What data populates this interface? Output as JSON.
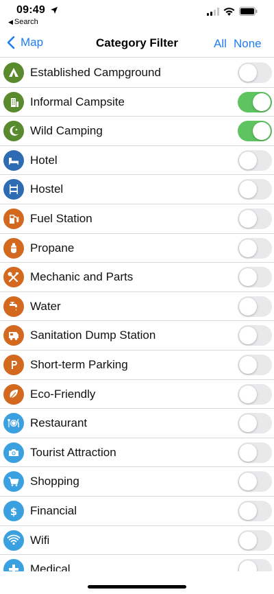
{
  "status_bar": {
    "time": "09:49",
    "back_app": "Search"
  },
  "nav": {
    "back_label": "Map",
    "title": "Category Filter",
    "all_label": "All",
    "none_label": "None"
  },
  "colors": {
    "green": "#5a8a2e",
    "blue": "#2d6bb3",
    "orange": "#d2691e",
    "light_blue": "#3aa0e0",
    "toggle_on": "#5ec45f",
    "link": "#1e7cf2"
  },
  "categories": [
    {
      "label": "Established Campground",
      "icon": "tent-icon",
      "color": "#5a8a2e",
      "on": false
    },
    {
      "label": "Informal Campsite",
      "icon": "building-icon",
      "color": "#5a8a2e",
      "on": true
    },
    {
      "label": "Wild Camping",
      "icon": "moon-icon",
      "color": "#5a8a2e",
      "on": true
    },
    {
      "label": "Hotel",
      "icon": "bed-icon",
      "color": "#2d6bb3",
      "on": false
    },
    {
      "label": "Hostel",
      "icon": "bunk-bed-icon",
      "color": "#2d6bb3",
      "on": false
    },
    {
      "label": "Fuel Station",
      "icon": "fuel-pump-icon",
      "color": "#d2691e",
      "on": false
    },
    {
      "label": "Propane",
      "icon": "propane-tank-icon",
      "color": "#d2691e",
      "on": false
    },
    {
      "label": "Mechanic and Parts",
      "icon": "wrench-icon",
      "color": "#d2691e",
      "on": false
    },
    {
      "label": "Water",
      "icon": "faucet-icon",
      "color": "#d2691e",
      "on": false
    },
    {
      "label": "Sanitation Dump Station",
      "icon": "rv-icon",
      "color": "#d2691e",
      "on": false
    },
    {
      "label": "Short-term Parking",
      "icon": "parking-icon",
      "color": "#d2691e",
      "on": false
    },
    {
      "label": "Eco-Friendly",
      "icon": "leaf-icon",
      "color": "#d2691e",
      "on": false
    },
    {
      "label": "Restaurant",
      "icon": "plate-icon",
      "color": "#3aa0e0",
      "on": false
    },
    {
      "label": "Tourist Attraction",
      "icon": "camera-icon",
      "color": "#3aa0e0",
      "on": false
    },
    {
      "label": "Shopping",
      "icon": "cart-icon",
      "color": "#3aa0e0",
      "on": false
    },
    {
      "label": "Financial",
      "icon": "dollar-icon",
      "color": "#3aa0e0",
      "on": false
    },
    {
      "label": "Wifi",
      "icon": "wifi-icon",
      "color": "#3aa0e0",
      "on": false
    },
    {
      "label": "Medical",
      "icon": "medical-icon",
      "color": "#3aa0e0",
      "on": false
    }
  ]
}
